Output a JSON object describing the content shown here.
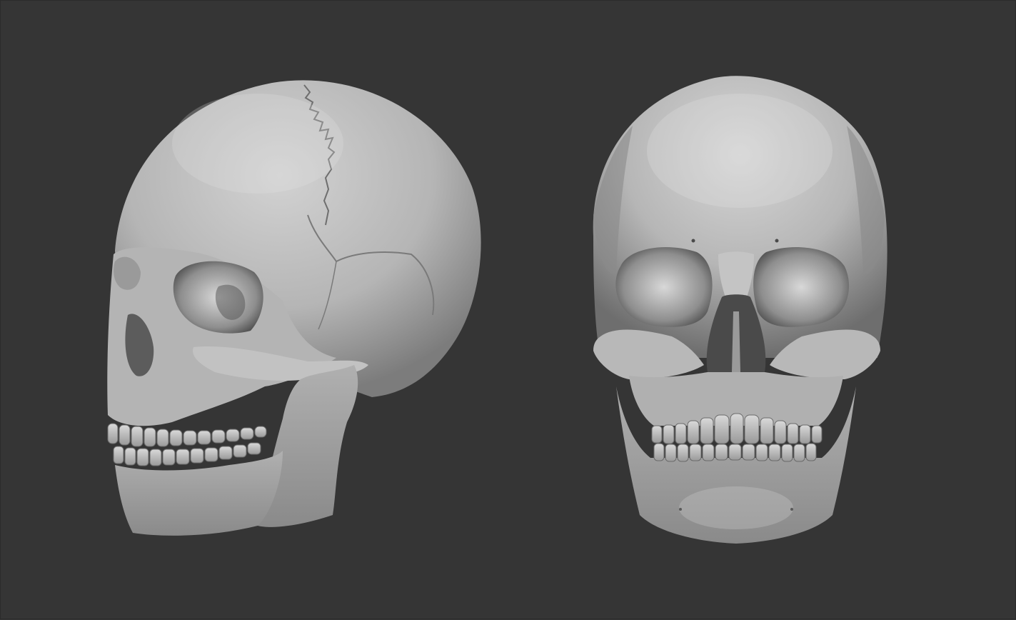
{
  "scene": {
    "background_color": "#353535",
    "bone_color": "#bdbdbd",
    "shadow_color": "#3a3a3a",
    "views": [
      {
        "id": "three-quarter",
        "subject": "skull"
      },
      {
        "id": "front",
        "subject": "skull"
      }
    ]
  }
}
